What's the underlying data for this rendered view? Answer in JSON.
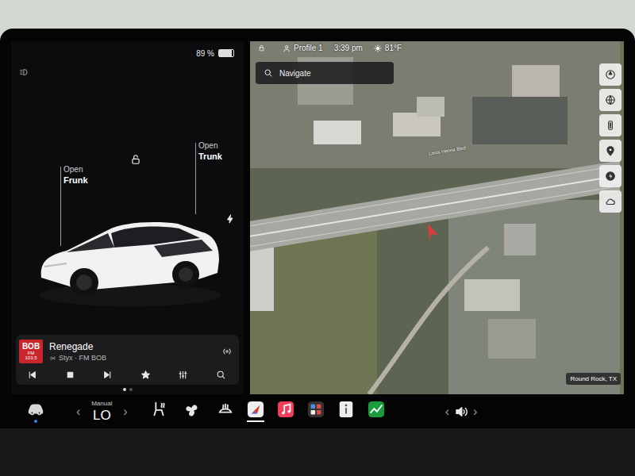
{
  "status": {
    "battery": "89 %",
    "battery_level": 0.89,
    "profile": "Profile 1",
    "time": "3:39 pm",
    "temperature": "81°F"
  },
  "car": {
    "frunk": {
      "action": "Open",
      "label": "Frunk"
    },
    "trunk": {
      "action": "Open",
      "label": "Trunk"
    },
    "locked": false,
    "charging": true
  },
  "media": {
    "logo": {
      "name": "BOB",
      "band": "FM",
      "frequency": "103.5"
    },
    "title": "Renegade",
    "artist": "Styx · FM BOB",
    "pages": [
      {
        "selected": true
      },
      {
        "selected": false
      }
    ]
  },
  "map": {
    "search": {
      "placeholder": "Navigate"
    },
    "road": "Louis Henna Blvd",
    "location": "Round Rock, TX"
  },
  "climate": {
    "mode": "Manual",
    "temperature": "LO",
    "left": "‹",
    "right": "›"
  },
  "dock": {
    "apps": [
      {
        "kind": "seat",
        "selected": false
      },
      {
        "kind": "fan",
        "selected": false
      },
      {
        "kind": "defrost",
        "selected": false
      },
      {
        "kind": "navigation",
        "selected": true
      },
      {
        "kind": "music",
        "selected": false
      },
      {
        "kind": "apps",
        "selected": false
      },
      {
        "kind": "info",
        "selected": false
      },
      {
        "kind": "chart",
        "selected": false
      }
    ]
  },
  "volume": {
    "left": "‹",
    "right": "›"
  }
}
